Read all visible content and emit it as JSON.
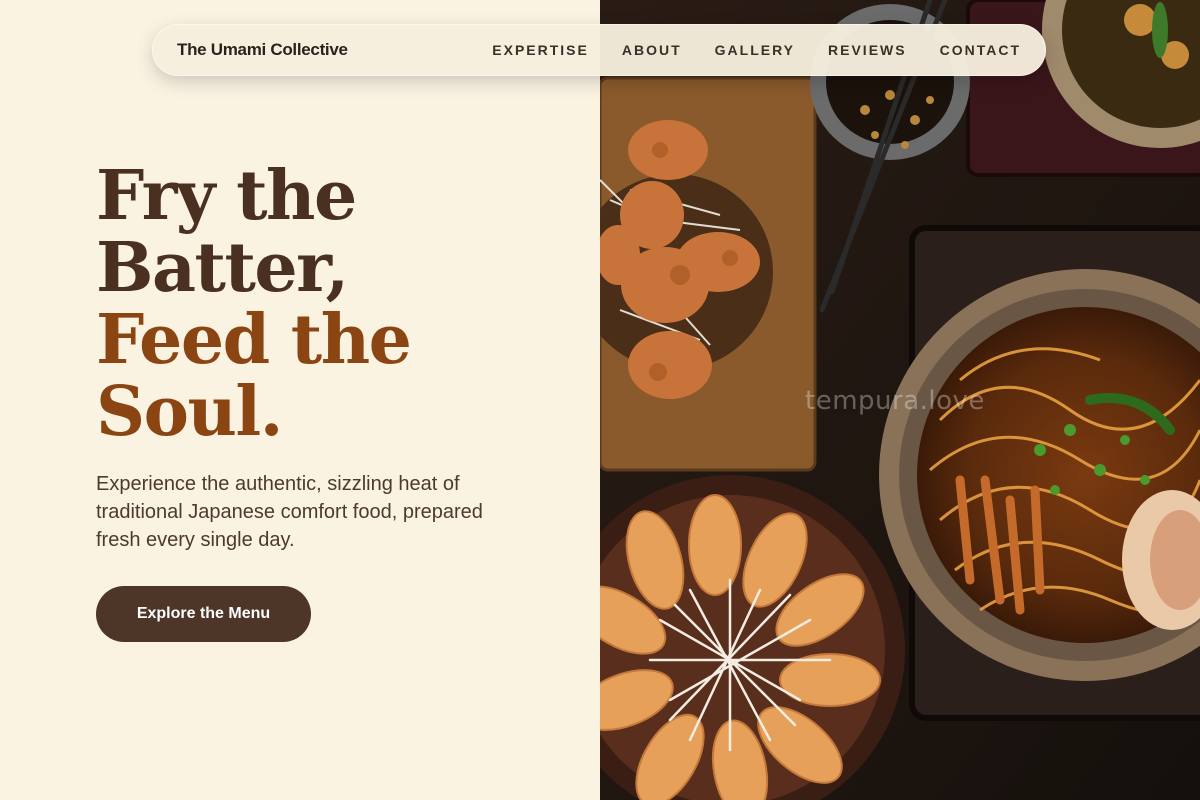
{
  "nav": {
    "brand": "The Umami Collective",
    "links": [
      "EXPERTISE",
      "ABOUT",
      "GALLERY",
      "REVIEWS",
      "CONTACT"
    ]
  },
  "hero": {
    "title_line1": "Fry the",
    "title_line2": "Batter,",
    "title_line3": "Feed the",
    "title_line4": "Soul.",
    "subtitle": "Experience the authentic, sizzling heat of traditional Japanese comfort food, prepared fresh every single day.",
    "cta_label": "Explore the Menu"
  },
  "image": {
    "watermark": "tempura.love"
  },
  "colors": {
    "background": "#fbf3e2",
    "title_dark": "#4a3020",
    "title_accent": "#8b4513",
    "button": "#4d3527"
  }
}
